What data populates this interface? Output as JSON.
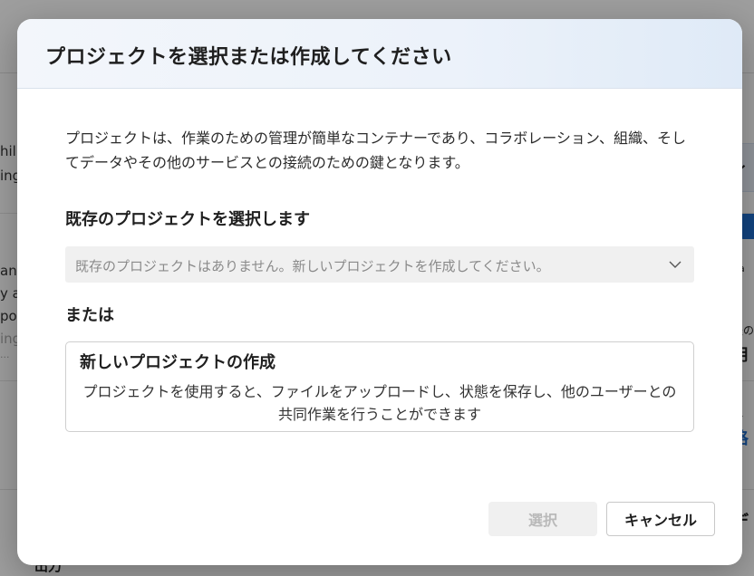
{
  "background": {
    "left_text": [
      "hil",
      "ing",
      "an",
      "y a",
      "po",
      "ing",
      "..."
    ],
    "right_text": [
      "イ",
      "ha",
      "後の",
      "用",
      "略",
      "格",
      "デ"
    ],
    "bottom_text": "出力"
  },
  "dialog": {
    "title": "プロジェクトを選択または作成してください",
    "description": "プロジェクトは、作業のための管理が簡単なコンテナーであり、コラボレーション、組織、そしてデータやその他のサービスとの接続のための鍵となります。",
    "existing_label": "既存のプロジェクトを選択します",
    "select": {
      "value": "既存のプロジェクトはありません。新しいプロジェクトを作成してください。",
      "icon": "chevron-down-icon"
    },
    "or_label": "または",
    "create_card": {
      "title": "新しいプロジェクトの作成",
      "description": "プロジェクトを使用すると、ファイルをアップロードし、状態を保存し、他のユーザーとの共同作業を行うことができます"
    },
    "buttons": {
      "select": "選択",
      "cancel": "キャンセル"
    }
  },
  "colors": {
    "overlay": "#000000",
    "header_gradient_end": "#dfeaf7",
    "disabled_button": "#f0f0f0",
    "accent": "#1d6fd1"
  }
}
